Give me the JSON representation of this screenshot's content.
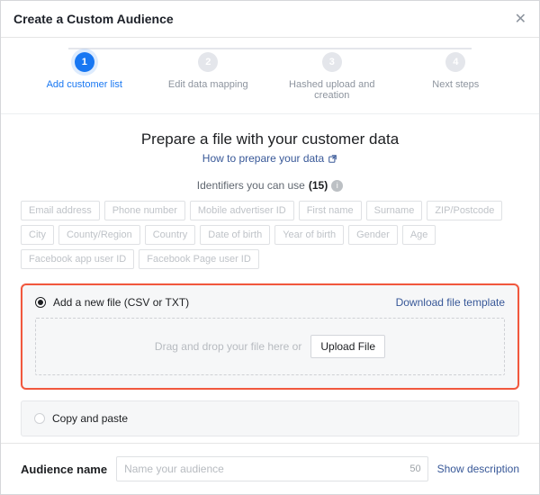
{
  "modal": {
    "title": "Create a Custom Audience",
    "close_glyph": "✕"
  },
  "stepper": {
    "s1": {
      "num": "1",
      "label": "Add customer list"
    },
    "s2": {
      "num": "2",
      "label": "Edit data mapping"
    },
    "s3": {
      "num": "3",
      "label": "Hashed upload and creation"
    },
    "s4": {
      "num": "4",
      "label": "Next steps"
    }
  },
  "section": {
    "title": "Prepare a file with your customer data",
    "help_link": "How to prepare your data"
  },
  "identifiers": {
    "label_prefix": "Identifiers you can use ",
    "count": "(15)",
    "chips": {
      "c0": "Email address",
      "c1": "Phone number",
      "c2": "Mobile advertiser ID",
      "c3": "First name",
      "c4": "Surname",
      "c5": "ZIP/Postcode",
      "c6": "City",
      "c7": "County/Region",
      "c8": "Country",
      "c9": "Date of birth",
      "c10": "Year of birth",
      "c11": "Gender",
      "c12": "Age",
      "c13": "Facebook app user ID",
      "c14": "Facebook Page user ID"
    }
  },
  "upload": {
    "radio_label": "Add a new file (CSV or TXT)",
    "download_template": "Download file template",
    "dropzone_text": "Drag and drop your file here or",
    "upload_button": "Upload File"
  },
  "copy_paste": {
    "radio_label": "Copy and paste"
  },
  "footer": {
    "label": "Audience name",
    "placeholder": "Name your audience",
    "char_limit": "50",
    "show_description": "Show description"
  }
}
